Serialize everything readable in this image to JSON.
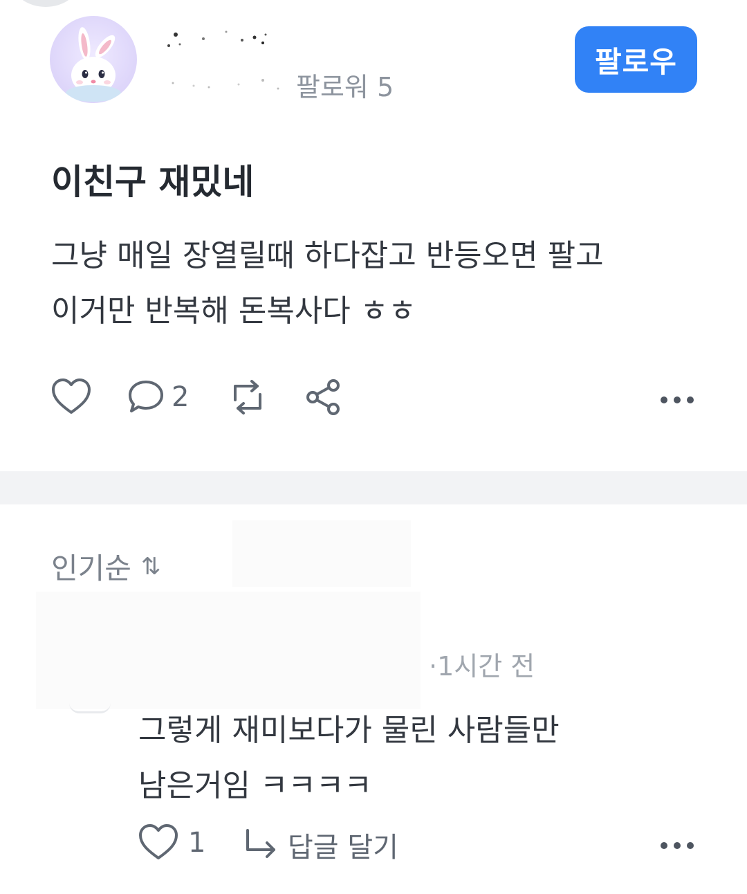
{
  "author": {
    "followers_label": "팔로워 5",
    "follow_button": "팔로우"
  },
  "post": {
    "title": "이친구 재밌네",
    "body_line1": "그냥 매일 장열릴때 하다잡고 반등오면 팔고",
    "body_line2": "이거만 반복해 돈복사다 ㅎㅎ",
    "comment_count": "2"
  },
  "comments": {
    "sort_label": "인기순",
    "sort_icon": "sort-arrows-icon",
    "items": [
      {
        "time": "·1시간 전",
        "body_line1": "그렇게 재미보다가 물린 사람들만",
        "body_line2": "남은거임 ㅋㅋㅋㅋ",
        "like_count": "1",
        "reply_label": "답글 달기"
      }
    ]
  },
  "colors": {
    "accent": "#3182f6",
    "icon": "#5f6772",
    "divider": "#f2f3f5",
    "muted_text": "#8d949e"
  }
}
